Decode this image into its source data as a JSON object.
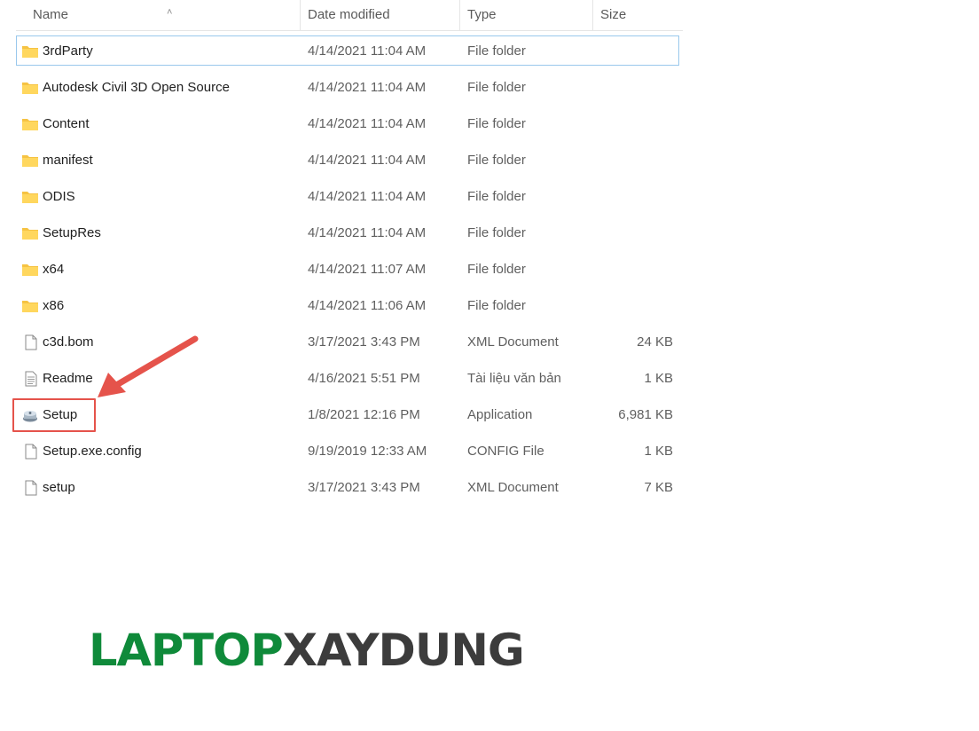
{
  "columns": {
    "name": "Name",
    "date": "Date modified",
    "type": "Type",
    "size": "Size"
  },
  "files": [
    {
      "name": "3rdParty",
      "date": "4/14/2021 11:04 AM",
      "type": "File folder",
      "size": "",
      "icon": "folder-icon"
    },
    {
      "name": "Autodesk Civil 3D Open Source",
      "date": "4/14/2021 11:04 AM",
      "type": "File folder",
      "size": "",
      "icon": "folder-icon"
    },
    {
      "name": "Content",
      "date": "4/14/2021 11:04 AM",
      "type": "File folder",
      "size": "",
      "icon": "folder-icon"
    },
    {
      "name": "manifest",
      "date": "4/14/2021 11:04 AM",
      "type": "File folder",
      "size": "",
      "icon": "folder-icon"
    },
    {
      "name": "ODIS",
      "date": "4/14/2021 11:04 AM",
      "type": "File folder",
      "size": "",
      "icon": "folder-icon"
    },
    {
      "name": "SetupRes",
      "date": "4/14/2021 11:04 AM",
      "type": "File folder",
      "size": "",
      "icon": "folder-icon"
    },
    {
      "name": "x64",
      "date": "4/14/2021 11:07 AM",
      "type": "File folder",
      "size": "",
      "icon": "folder-icon"
    },
    {
      "name": "x86",
      "date": "4/14/2021 11:06 AM",
      "type": "File folder",
      "size": "",
      "icon": "folder-icon"
    },
    {
      "name": "c3d.bom",
      "date": "3/17/2021 3:43 PM",
      "type": "XML Document",
      "size": "24 KB",
      "icon": "document-icon"
    },
    {
      "name": "Readme",
      "date": "4/16/2021 5:51 PM",
      "type": "Tài liệu văn bản",
      "size": "1 KB",
      "icon": "text-file-icon"
    },
    {
      "name": "Setup",
      "date": "1/8/2021 12:16 PM",
      "type": "Application",
      "size": "6,981 KB",
      "icon": "installer-icon"
    },
    {
      "name": "Setup.exe.config",
      "date": "9/19/2019 12:33 AM",
      "type": "CONFIG File",
      "size": "1 KB",
      "icon": "document-icon"
    },
    {
      "name": "setup",
      "date": "3/17/2021 3:43 PM",
      "type": "XML Document",
      "size": "7 KB",
      "icon": "document-icon"
    }
  ],
  "logo": {
    "part1": "LAPTOP",
    "part2": "XAYDUNG"
  },
  "colors": {
    "callout": "#e5534b",
    "selection_border": "#99c8ec",
    "logo_green": "#0f8a3a",
    "logo_dark": "#3c3c3c"
  }
}
